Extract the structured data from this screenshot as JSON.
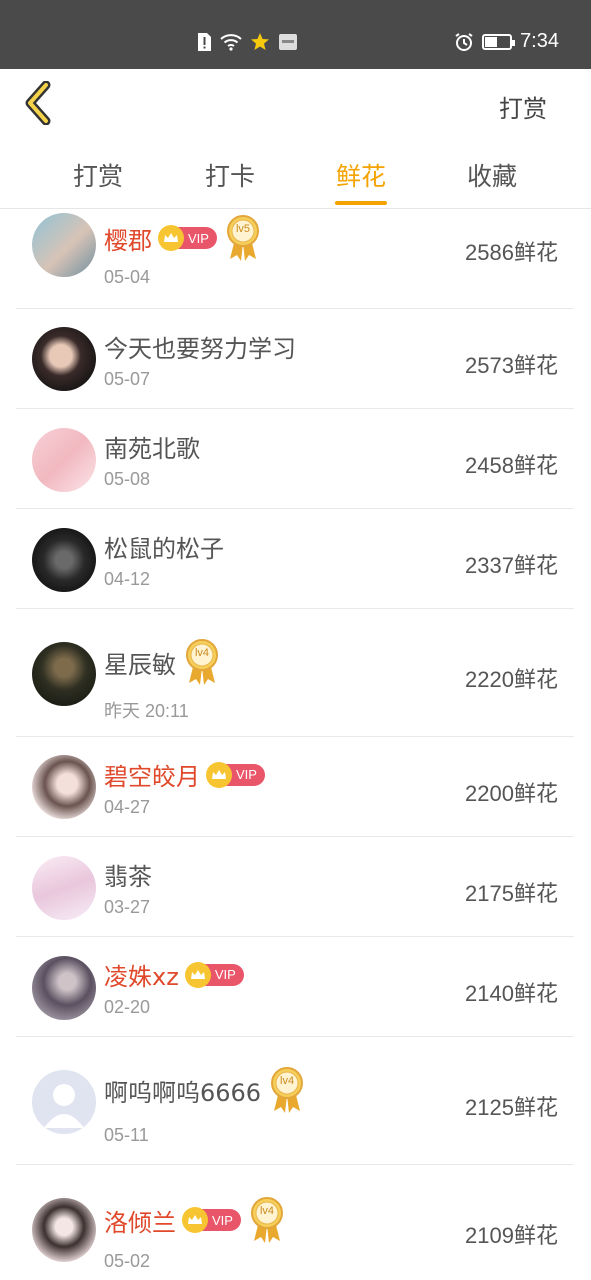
{
  "status_bar": {
    "time": "7:34"
  },
  "header": {
    "right_action": "打赏"
  },
  "tabs": [
    {
      "label": "打赏",
      "active": false
    },
    {
      "label": "打卡",
      "active": false
    },
    {
      "label": "鲜花",
      "active": true
    },
    {
      "label": "收藏",
      "active": false
    }
  ],
  "list": [
    {
      "name": "樱郡",
      "vip": true,
      "level": "lv5",
      "date": "05-04",
      "count": "2586鲜花"
    },
    {
      "name": "今天也要努力学习",
      "vip": false,
      "level": "",
      "date": "05-07",
      "count": "2573鲜花"
    },
    {
      "name": "南苑北歌",
      "vip": false,
      "level": "",
      "date": "05-08",
      "count": "2458鲜花"
    },
    {
      "name": "松鼠的松子",
      "vip": false,
      "level": "",
      "date": "04-12",
      "count": "2337鲜花"
    },
    {
      "name": "星辰敏",
      "vip": false,
      "level": "lv4",
      "date": "昨天 20:11",
      "count": "2220鲜花"
    },
    {
      "name": "碧空皎月",
      "vip": true,
      "level": "",
      "date": "04-27",
      "count": "2200鲜花"
    },
    {
      "name": "翡茶",
      "vip": false,
      "level": "",
      "date": "03-27",
      "count": "2175鲜花"
    },
    {
      "name": "凌姝xz",
      "vip": true,
      "level": "",
      "date": "02-20",
      "count": "2140鲜花"
    },
    {
      "name": "啊呜啊呜6666",
      "vip": false,
      "level": "lv4",
      "date": "05-11",
      "count": "2125鲜花"
    },
    {
      "name": "洛倾兰",
      "vip": true,
      "level": "lv4",
      "date": "05-02",
      "count": "2109鲜花"
    }
  ],
  "vip_label": "VIP",
  "colors": {
    "accent": "#f5a300",
    "vip_name": "#e0492b",
    "status_bar": "#4a4a4a"
  }
}
